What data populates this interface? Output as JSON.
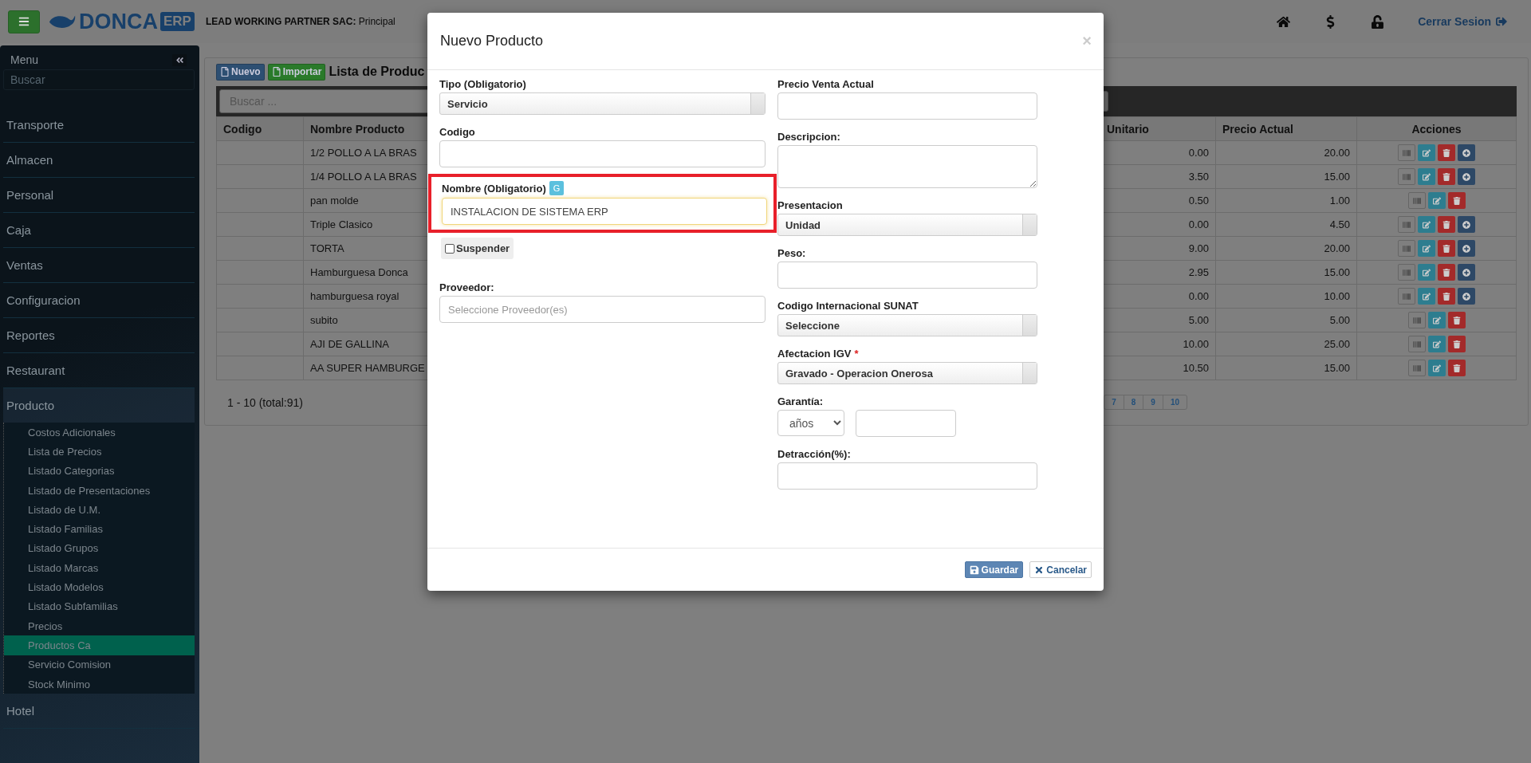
{
  "header": {
    "logo": {
      "name": "DONCA",
      "badge": "ERP"
    },
    "company": {
      "name": "LEAD WORKING PARTNER SAC:",
      "branch": "Principal"
    },
    "logout": "Cerrar Sesion"
  },
  "sidebar": {
    "title": "Menu",
    "search_placeholder": "Buscar",
    "items": [
      {
        "label": "Transporte",
        "expanded": false
      },
      {
        "label": "Almacen",
        "expanded": false
      },
      {
        "label": "Personal",
        "expanded": false
      },
      {
        "label": "Caja",
        "expanded": false
      },
      {
        "label": "Ventas",
        "expanded": false
      },
      {
        "label": "Configuracion",
        "expanded": false
      },
      {
        "label": "Reportes",
        "expanded": false
      },
      {
        "label": "Restaurant",
        "expanded": false
      },
      {
        "label": "Producto",
        "expanded": true,
        "children": [
          {
            "label": "Costos Adicionales",
            "selected": false
          },
          {
            "label": "Lista de Precios",
            "selected": false
          },
          {
            "label": "Listado Categorias",
            "selected": false
          },
          {
            "label": "Listado de Presentaciones",
            "selected": false
          },
          {
            "label": "Listado de U.M.",
            "selected": false
          },
          {
            "label": "Listado Familias",
            "selected": false
          },
          {
            "label": "Listado Grupos",
            "selected": false
          },
          {
            "label": "Listado Marcas",
            "selected": false
          },
          {
            "label": "Listado Modelos",
            "selected": false
          },
          {
            "label": "Listado Subfamilias",
            "selected": false
          },
          {
            "label": "Precios",
            "selected": false
          },
          {
            "label": "Productos Ca",
            "selected": true
          },
          {
            "label": "Servicio Comision",
            "selected": false
          },
          {
            "label": "Stock Minimo",
            "selected": false
          }
        ]
      },
      {
        "label": "Hotel",
        "expanded": false
      }
    ]
  },
  "content": {
    "buttons": [
      {
        "label": "Nuevo",
        "kind": "primary"
      },
      {
        "label": "Importar",
        "kind": "success"
      }
    ],
    "title": "Lista de Produc",
    "search": {
      "placeholder": "Buscar ..."
    },
    "table": {
      "columns": [
        "Codigo",
        "Nombre Producto",
        "Unitario",
        "Precio Actual",
        "Acciones"
      ],
      "rows": [
        {
          "name": "1/2 POLLO A LA BRAS",
          "unit": "0.00",
          "price": "20.00",
          "actions": [
            {
              "kind": "barcode"
            },
            {
              "kind": "edit"
            },
            {
              "kind": "delete"
            },
            {
              "kind": "add"
            }
          ]
        },
        {
          "name": "1/4 POLLO A LA BRAS",
          "unit": "3.50",
          "price": "15.00",
          "actions": [
            {
              "kind": "barcode"
            },
            {
              "kind": "edit"
            },
            {
              "kind": "delete"
            },
            {
              "kind": "add"
            }
          ]
        },
        {
          "name": "pan molde",
          "unit": "0.50",
          "price": "1.00",
          "actions": [
            {
              "kind": "barcode"
            },
            {
              "kind": "edit"
            },
            {
              "kind": "delete"
            }
          ]
        },
        {
          "name": "Triple Clasico",
          "unit": "0.00",
          "price": "4.50",
          "actions": [
            {
              "kind": "barcode"
            },
            {
              "kind": "edit"
            },
            {
              "kind": "delete"
            },
            {
              "kind": "add"
            }
          ]
        },
        {
          "name": "TORTA",
          "unit": "9.00",
          "price": "20.00",
          "actions": [
            {
              "kind": "barcode"
            },
            {
              "kind": "edit"
            },
            {
              "kind": "delete"
            },
            {
              "kind": "add"
            }
          ]
        },
        {
          "name": "Hamburguesa Donca",
          "unit": "2.95",
          "price": "15.00",
          "actions": [
            {
              "kind": "barcode"
            },
            {
              "kind": "edit"
            },
            {
              "kind": "delete"
            },
            {
              "kind": "add"
            }
          ]
        },
        {
          "name": "hamburguesa royal",
          "unit": "0.00",
          "price": "10.00",
          "actions": [
            {
              "kind": "barcode"
            },
            {
              "kind": "edit"
            },
            {
              "kind": "delete"
            },
            {
              "kind": "add"
            }
          ]
        },
        {
          "name": "subito",
          "unit": "5.00",
          "price": "5.00",
          "actions": [
            {
              "kind": "barcode"
            },
            {
              "kind": "edit"
            },
            {
              "kind": "delete"
            }
          ]
        },
        {
          "name": "AJI DE GALLINA",
          "unit": "10.00",
          "price": "25.00",
          "actions": [
            {
              "kind": "barcode"
            },
            {
              "kind": "edit"
            },
            {
              "kind": "delete"
            }
          ]
        },
        {
          "name": "AA SUPER HAMBURGE",
          "unit": "10.50",
          "price": "15.00",
          "actions": [
            {
              "kind": "barcode"
            },
            {
              "kind": "edit"
            },
            {
              "kind": "delete"
            }
          ]
        }
      ]
    },
    "pagination": {
      "summary": "1 - 10 (total:91)",
      "pages": [
        "7",
        "8",
        "9",
        "10"
      ]
    }
  },
  "modal": {
    "title": "Nuevo Producto",
    "close": "×",
    "left_fields": [
      {
        "kind": "select",
        "label": "Tipo (Obligatorio)",
        "value": "Servicio"
      },
      {
        "kind": "input",
        "label": "Codigo"
      },
      {
        "kind": "input",
        "label": "Nombre (Obligatorio)",
        "badge": "G",
        "value": "INSTALACION DE SISTEMA ERP",
        "highlighted": true
      },
      {
        "kind": "checkbox",
        "label": "Suspender",
        "checked": false
      },
      {
        "kind": "input",
        "label": "Proveedor:",
        "placeholder": "Seleccione Proveedor(es)"
      }
    ],
    "right_fields": [
      {
        "kind": "input",
        "label": "Precio Venta Actual"
      },
      {
        "kind": "textarea",
        "label": "Descripcion:"
      },
      {
        "kind": "select",
        "label": "Presentacion",
        "value": "Unidad"
      },
      {
        "kind": "input",
        "label": "Peso:"
      },
      {
        "kind": "select",
        "label": "Codigo Internacional SUNAT",
        "value": "Seleccione"
      },
      {
        "kind": "select",
        "label": "Afectacion IGV",
        "value": "Gravado - Operacion Onerosa",
        "required_mark": "*"
      },
      {
        "kind": "guarantee",
        "label": "Garantía:",
        "unit": "años"
      },
      {
        "kind": "input",
        "label": "Detracción(%):"
      }
    ],
    "buttons": [
      {
        "label": "Guardar",
        "kind": "primary"
      },
      {
        "label": "Cancelar",
        "kind": "default"
      }
    ]
  }
}
